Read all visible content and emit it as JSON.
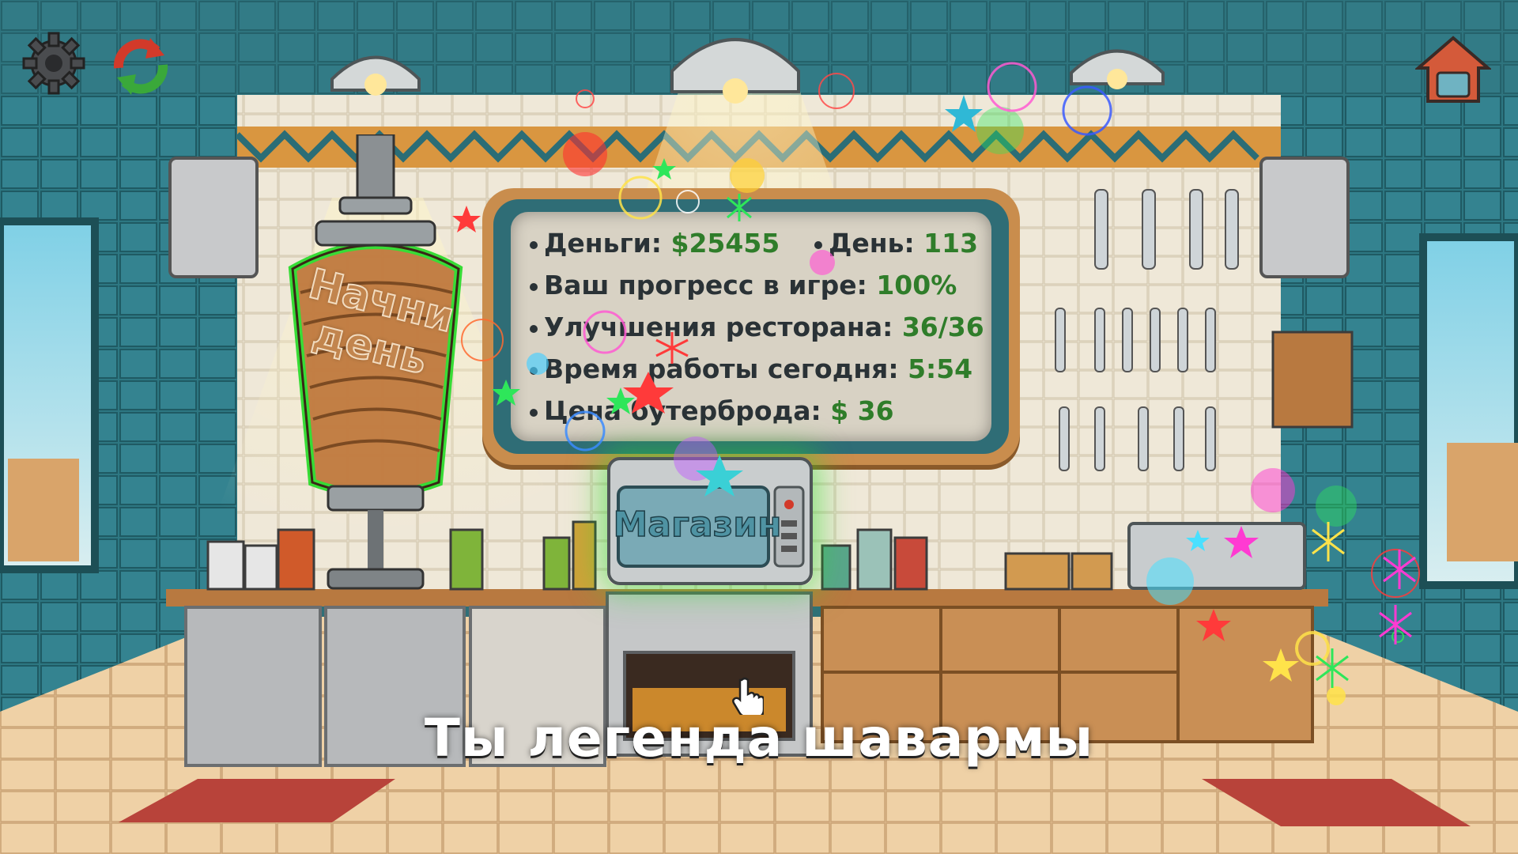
{
  "stats": {
    "money_label": "Деньги:",
    "money_value": "$25455",
    "day_label": "День:",
    "day_value": "113",
    "progress_label": "Ваш прогресс в игре:",
    "progress_value": "100%",
    "upgrades_label": "Улучшения ресторана:",
    "upgrades_value": "36/36",
    "worktime_label": "Время работы сегодня:",
    "worktime_value": "5:54",
    "price_label": "Цена бутерброда:",
    "price_value": "$ 36"
  },
  "buttons": {
    "start_day": "Начни день",
    "shop": "Магазин"
  },
  "caption": "Ты легенда шавармы",
  "icons": {
    "settings": "gear-icon",
    "restart": "refresh-icon",
    "home": "home-icon"
  },
  "colors": {
    "highlight": "#2edc2e",
    "value_text": "#2f7d2a",
    "board_frame": "#c98d4d",
    "board_teal": "#2f6d76"
  }
}
